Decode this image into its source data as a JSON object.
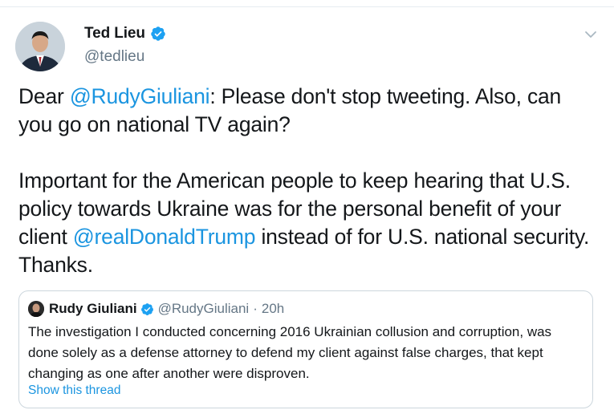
{
  "tweet": {
    "author": {
      "display_name": "Ted Lieu",
      "handle": "@tedlieu",
      "verified": true,
      "avatar_icon": "profile-photo"
    },
    "menu_icon": "chevron-down-icon",
    "text": {
      "p1_prefix": "Dear ",
      "p1_mention": "@RudyGiuliani",
      "p1_suffix": ": Please don't stop tweeting. Also, can you go on national TV again?",
      "p2_prefix": "Important for the American people to keep hearing that U.S. policy towards Ukraine was for the personal benefit of your client ",
      "p2_mention": "@realDonaldTrump",
      "p2_suffix": " instead of for U.S. national security. Thanks."
    },
    "quoted": {
      "display_name": "Rudy Giuliani",
      "handle": "@RudyGiuliani",
      "separator": "·",
      "time": "20h",
      "verified": true,
      "text": "The investigation I conducted concerning 2016 Ukrainian collusion and corruption, was done solely as a defense attorney to defend my client against false charges, that kept changing as one after another were disproven.",
      "show_thread_label": "Show this thread"
    }
  },
  "colors": {
    "link": "#1b95e0",
    "verified": "#1da1f2",
    "secondary_text": "#657786",
    "primary_text": "#14171a",
    "border": "#ccd6dd"
  }
}
